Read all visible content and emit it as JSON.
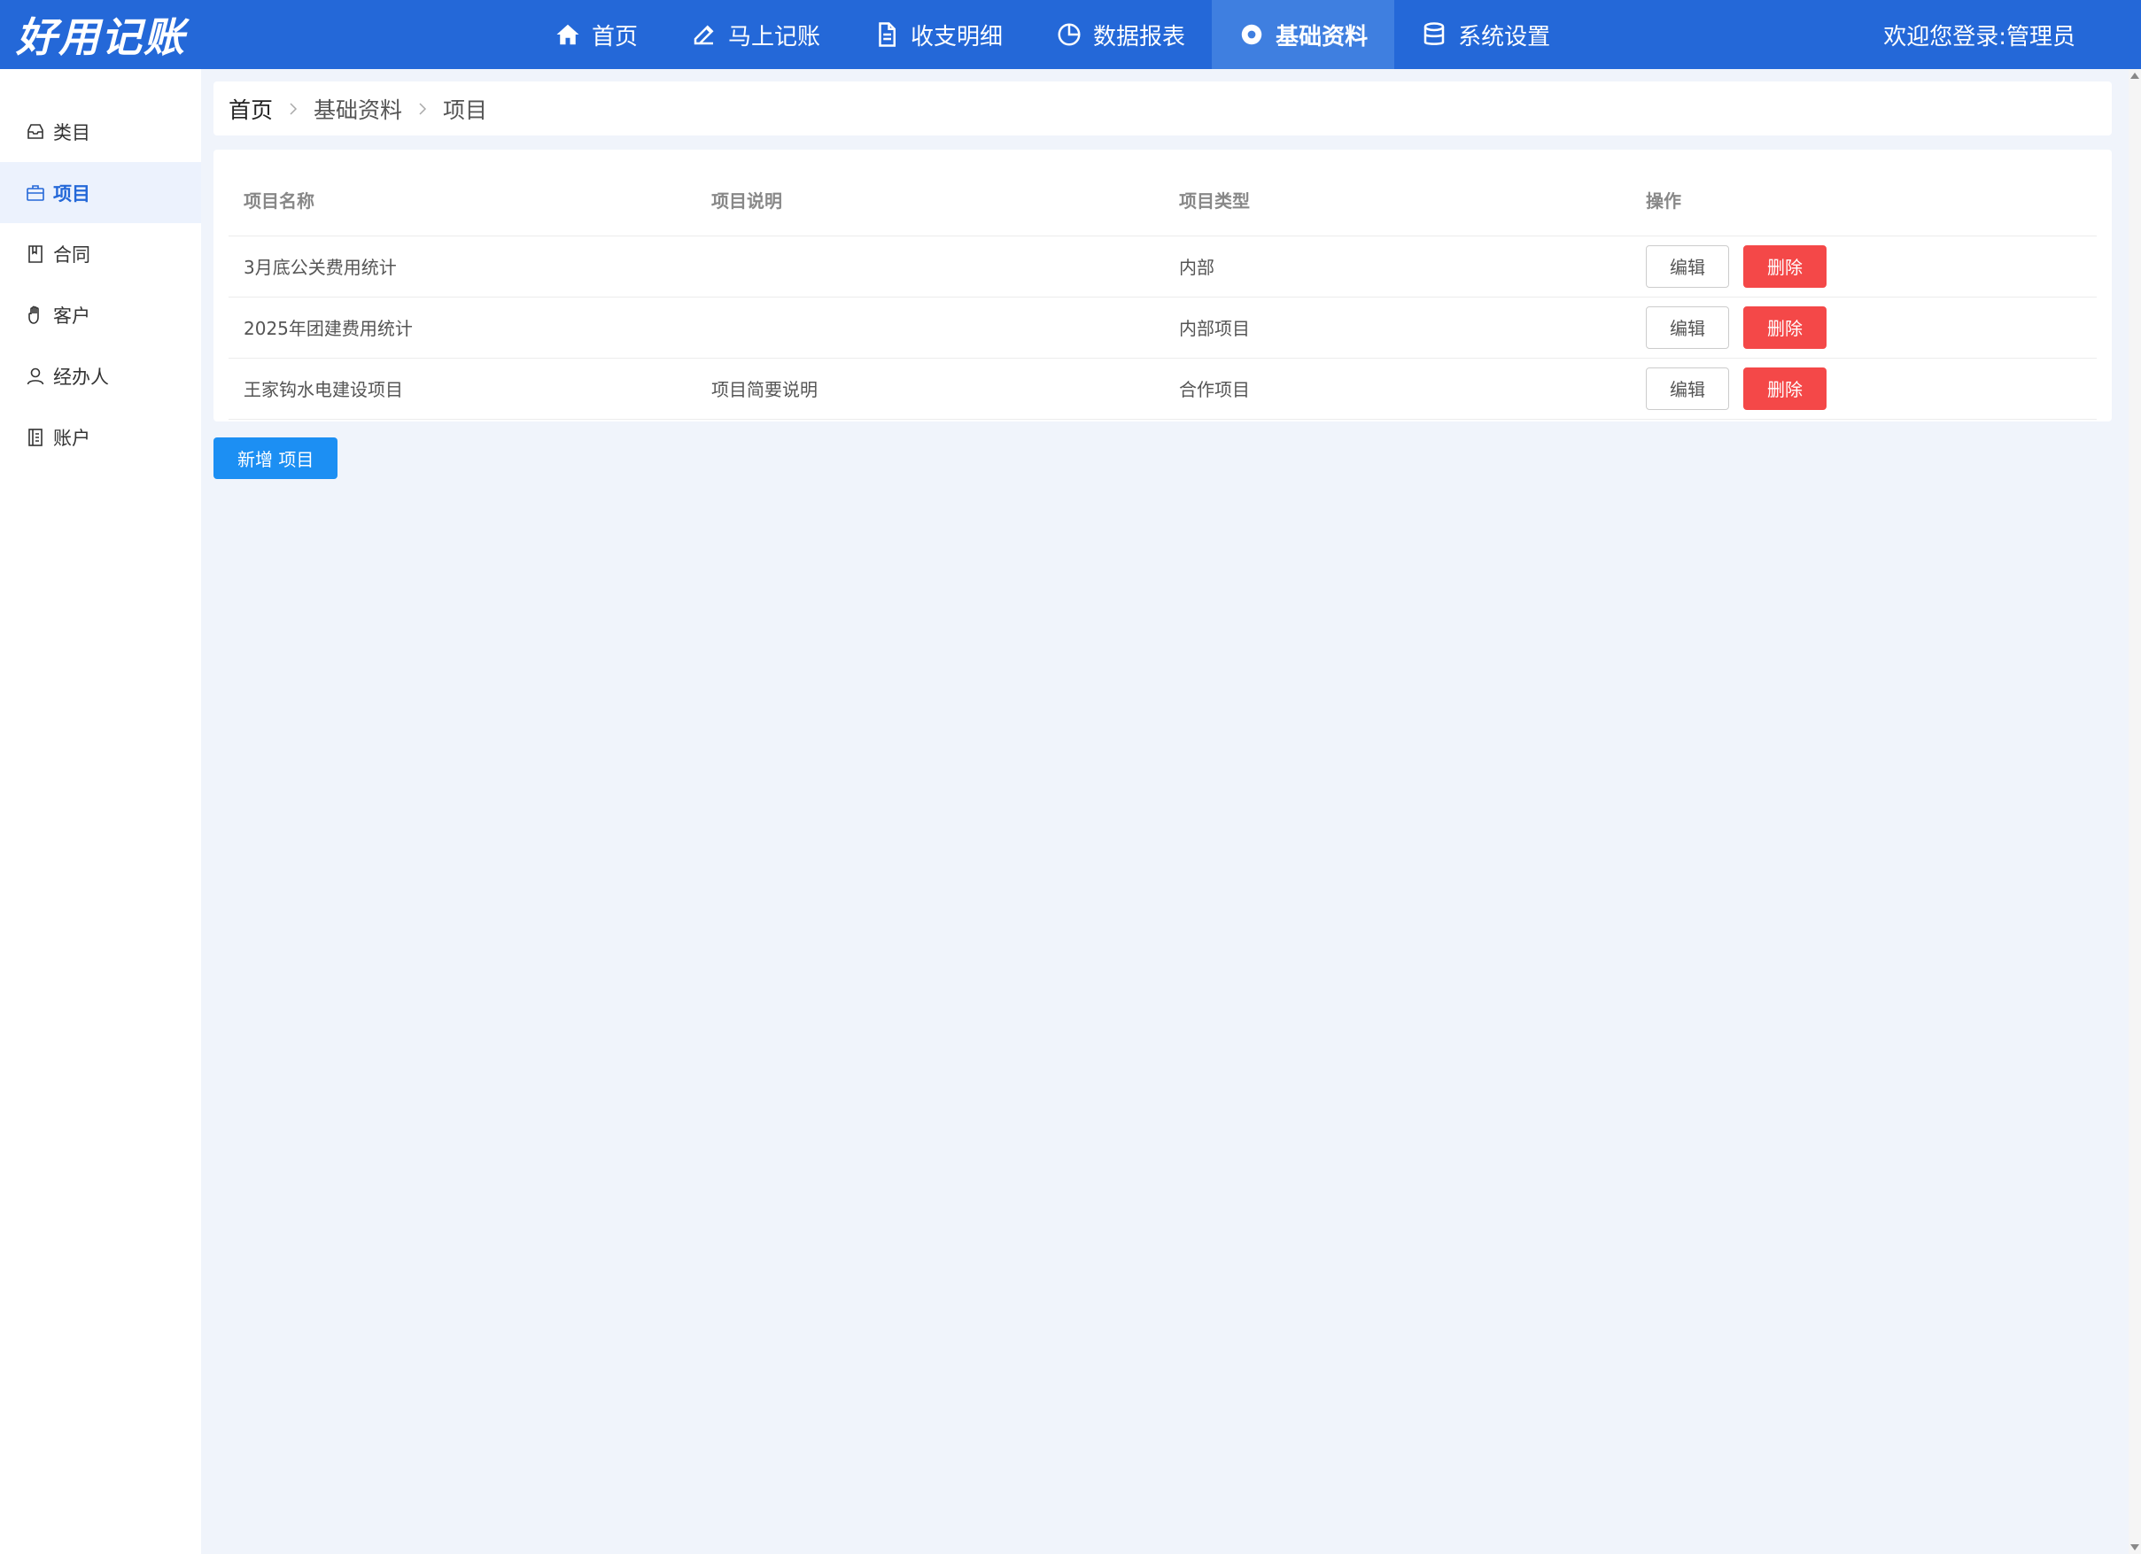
{
  "app": {
    "logo": "好用记账",
    "welcome": "欢迎您登录:管理员"
  },
  "nav": {
    "items": [
      {
        "label": "首页",
        "icon": "home-icon"
      },
      {
        "label": "马上记账",
        "icon": "edit-icon"
      },
      {
        "label": "收支明细",
        "icon": "document-icon"
      },
      {
        "label": "数据报表",
        "icon": "pie-chart-icon"
      },
      {
        "label": "基础资料",
        "icon": "gear-icon",
        "active": true
      },
      {
        "label": "系统设置",
        "icon": "database-icon"
      }
    ]
  },
  "sidebar": {
    "items": [
      {
        "label": "类目",
        "icon": "inbox-icon"
      },
      {
        "label": "项目",
        "icon": "briefcase-icon",
        "active": true
      },
      {
        "label": "合同",
        "icon": "book-icon"
      },
      {
        "label": "客户",
        "icon": "hand-icon"
      },
      {
        "label": "经办人",
        "icon": "user-icon"
      },
      {
        "label": "账户",
        "icon": "ledger-icon"
      }
    ]
  },
  "breadcrumb": {
    "items": [
      "首页",
      "基础资料",
      "项目"
    ]
  },
  "table": {
    "headers": [
      "项目名称",
      "项目说明",
      "项目类型",
      "操作"
    ],
    "rows": [
      {
        "name": "3月底公关费用统计",
        "desc": "",
        "type": "内部"
      },
      {
        "name": "2025年团建费用统计",
        "desc": "",
        "type": "内部项目"
      },
      {
        "name": "王家钩水电建设项目",
        "desc": "项目简要说明",
        "type": "合作项目"
      }
    ],
    "edit_label": "编辑",
    "delete_label": "删除"
  },
  "add_button": "新增 项目",
  "colors": {
    "topbar": "#2468d8",
    "active_nav": "#3f7fe0",
    "primary": "#1c8ff3",
    "danger": "#f44848",
    "background": "#f0f4fb"
  }
}
